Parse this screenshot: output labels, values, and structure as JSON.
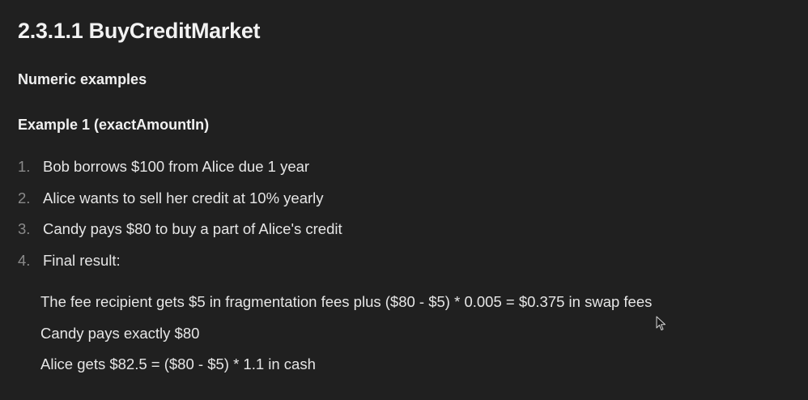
{
  "heading": "2.3.1.1 BuyCreditMarket",
  "subheading_numeric": "Numeric examples",
  "subheading_example": "Example 1 (exactAmountIn)",
  "steps": [
    {
      "num": "1.",
      "text": "Bob borrows $100 from Alice due 1 year"
    },
    {
      "num": "2.",
      "text": "Alice wants to sell her credit at 10% yearly"
    },
    {
      "num": "3.",
      "text": "Candy pays $80 to buy a part of Alice's credit"
    },
    {
      "num": "4.",
      "text": "Final result:"
    }
  ],
  "results": [
    "The fee recipient gets $5 in fragmentation fees plus ($80 - $5) * 0.005 = $0.375 in swap fees",
    "Candy pays exactly $80",
    "Alice gets $82.5 = ($80 - $5) * 1.1 in cash"
  ],
  "colors": {
    "background": "#202020",
    "text": "#e6e6e6",
    "list_number": "#8a8a8a"
  },
  "icons": [
    "mouse-pointer-icon"
  ]
}
